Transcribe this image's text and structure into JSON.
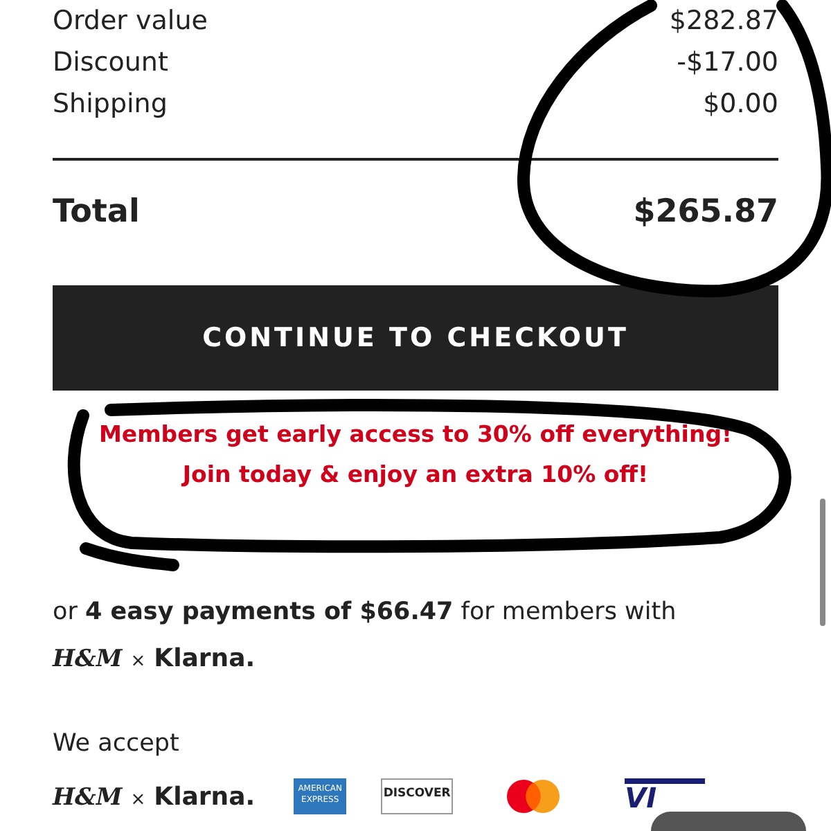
{
  "summary": [
    {
      "label": "Order value",
      "value": "$282.87"
    },
    {
      "label": "Discount",
      "value": "-$17.00"
    },
    {
      "label": "Shipping",
      "value": "$0.00"
    }
  ],
  "total": {
    "label": "Total",
    "value": "$265.87"
  },
  "checkout_button": "CONTINUE TO CHECKOUT",
  "promo": [
    "Members get early access to 30% off everything!",
    "Join today & enjoy an extra 10% off!"
  ],
  "installments": {
    "text": "or **4 easy payments of $66.47** for members with",
    "brand": {
      "left": "H&M",
      "sep": "×",
      "right": "Klarna."
    }
  },
  "accept": {
    "heading": "We accept",
    "methods": [
      {
        "kind": "klarna",
        "left": "H&M",
        "sep": "×",
        "right": "Klarna."
      },
      {
        "kind": "amex",
        "lines": [
          "AMERICAN",
          "EXPRESS"
        ]
      },
      {
        "kind": "discover",
        "label": "DISCOVER"
      },
      {
        "kind": "mastercard"
      },
      {
        "kind": "visa",
        "label": "VI"
      }
    ]
  }
}
